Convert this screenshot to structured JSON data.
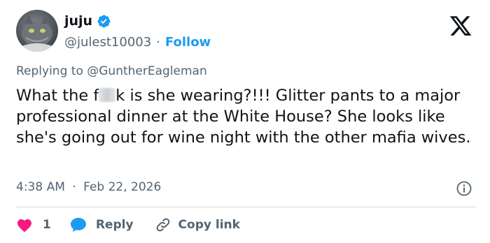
{
  "author": {
    "name": "juju",
    "handle": "@julest10003",
    "separator": "·",
    "follow_label": "Follow"
  },
  "reply_context": {
    "prefix": "Replying to",
    "mention": "@GuntherEagleman"
  },
  "tweet": {
    "text_before_blur": "What the f",
    "text_after_blur": "k is she wearing?!!! Glitter pants to a major professional dinner at the White House? She looks like she's going out for wine night with the other mafia wives."
  },
  "meta": {
    "time": "4:38 AM",
    "separator": "·",
    "date": "Feb 22, 2026"
  },
  "actions": {
    "like_count": "1",
    "reply_label": "Reply",
    "copy_label": "Copy link"
  },
  "colors": {
    "accent": "#1d9bf0",
    "muted": "#536471",
    "like": "#f91880",
    "divider": "#cfd9de"
  },
  "icons": [
    "verified-badge-icon",
    "x-logo-icon",
    "info-icon",
    "heart-icon",
    "reply-bubble-icon",
    "link-icon"
  ]
}
